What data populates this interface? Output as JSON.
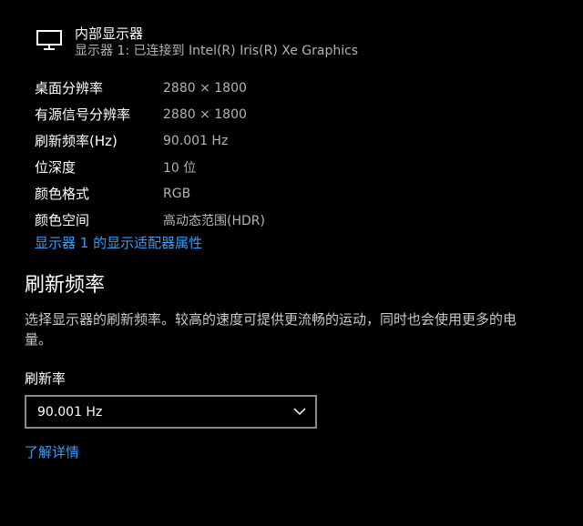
{
  "display": {
    "icon": "monitor-icon",
    "name": "内部显示器",
    "connection": "显示器 1: 已连接到 Intel(R) Iris(R) Xe Graphics"
  },
  "properties": [
    {
      "label": "桌面分辨率",
      "value": "2880 × 1800"
    },
    {
      "label": "有源信号分辨率",
      "value": "2880 × 1800"
    },
    {
      "label": "刷新频率(Hz)",
      "value": "90.001 Hz"
    },
    {
      "label": "位深度",
      "value": "10 位"
    },
    {
      "label": "颜色格式",
      "value": "RGB"
    },
    {
      "label": "颜色空间",
      "value": "高动态范围(HDR)"
    }
  ],
  "adapter_link": "显示器 1 的显示适配器属性",
  "refresh_section": {
    "title": "刷新频率",
    "description": "选择显示器的刷新频率。较高的速度可提供更流畅的运动，同时也会使用更多的电量。",
    "field_label": "刷新率",
    "selected": "90.001 Hz",
    "dropdown_icon": "chevron-down-icon"
  },
  "learn_more": "了解详情",
  "colors": {
    "background": "#000000",
    "link": "#3d9bf0",
    "secondary_text": "#b3b3b3"
  }
}
